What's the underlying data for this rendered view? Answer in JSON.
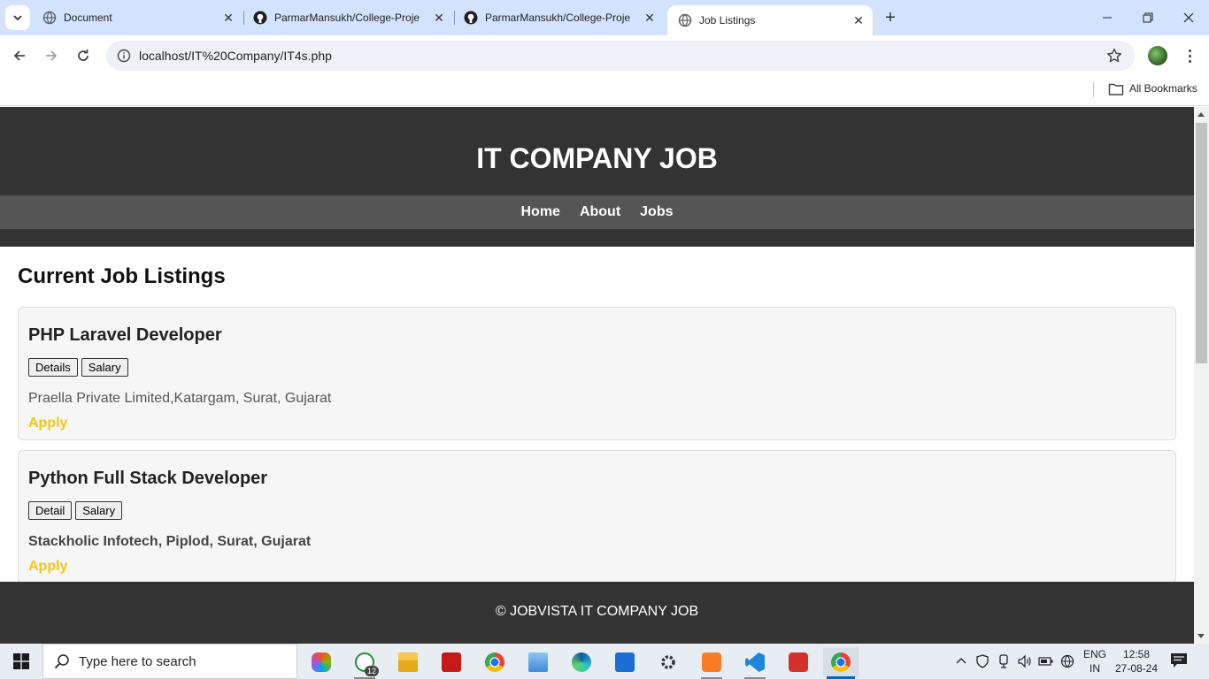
{
  "browser": {
    "tabs": [
      {
        "title": "Document",
        "icon": "globe-icon"
      },
      {
        "title": "ParmarMansukh/College-Proje",
        "icon": "github-icon"
      },
      {
        "title": "ParmarMansukh/College-Proje",
        "icon": "github-icon"
      },
      {
        "title": "Job Listings",
        "icon": "globe-icon",
        "active": true
      }
    ],
    "url": "localhost/IT%20Company/IT4s.php",
    "bookmarks_label": "All Bookmarks"
  },
  "site": {
    "title": "IT COMPANY JOB",
    "nav": [
      "Home",
      "About",
      "Jobs"
    ],
    "section_title": "Current Job Listings",
    "jobs": [
      {
        "title": "PHP Laravel Developer",
        "buttons": [
          "Details",
          "Salary"
        ],
        "company": "Praella Private Limited,Katargam, Surat, Gujarat",
        "apply": "Apply"
      },
      {
        "title": "Python Full Stack Developer",
        "buttons": [
          "Detail",
          "Salary"
        ],
        "company": "Stackholic Infotech, Piplod, Surat, Gujarat",
        "apply": "Apply"
      }
    ],
    "footer": "© JOBVISTA IT COMPANY JOB",
    "colors": {
      "header_bg": "#333333",
      "nav_bg": "#555555",
      "apply": "#f5c518"
    }
  },
  "taskbar": {
    "search_placeholder": "Type here to search",
    "whatsapp_badge": "12",
    "language": [
      "ENG",
      "IN"
    ],
    "time": "12:58",
    "date": "27-08-24"
  }
}
